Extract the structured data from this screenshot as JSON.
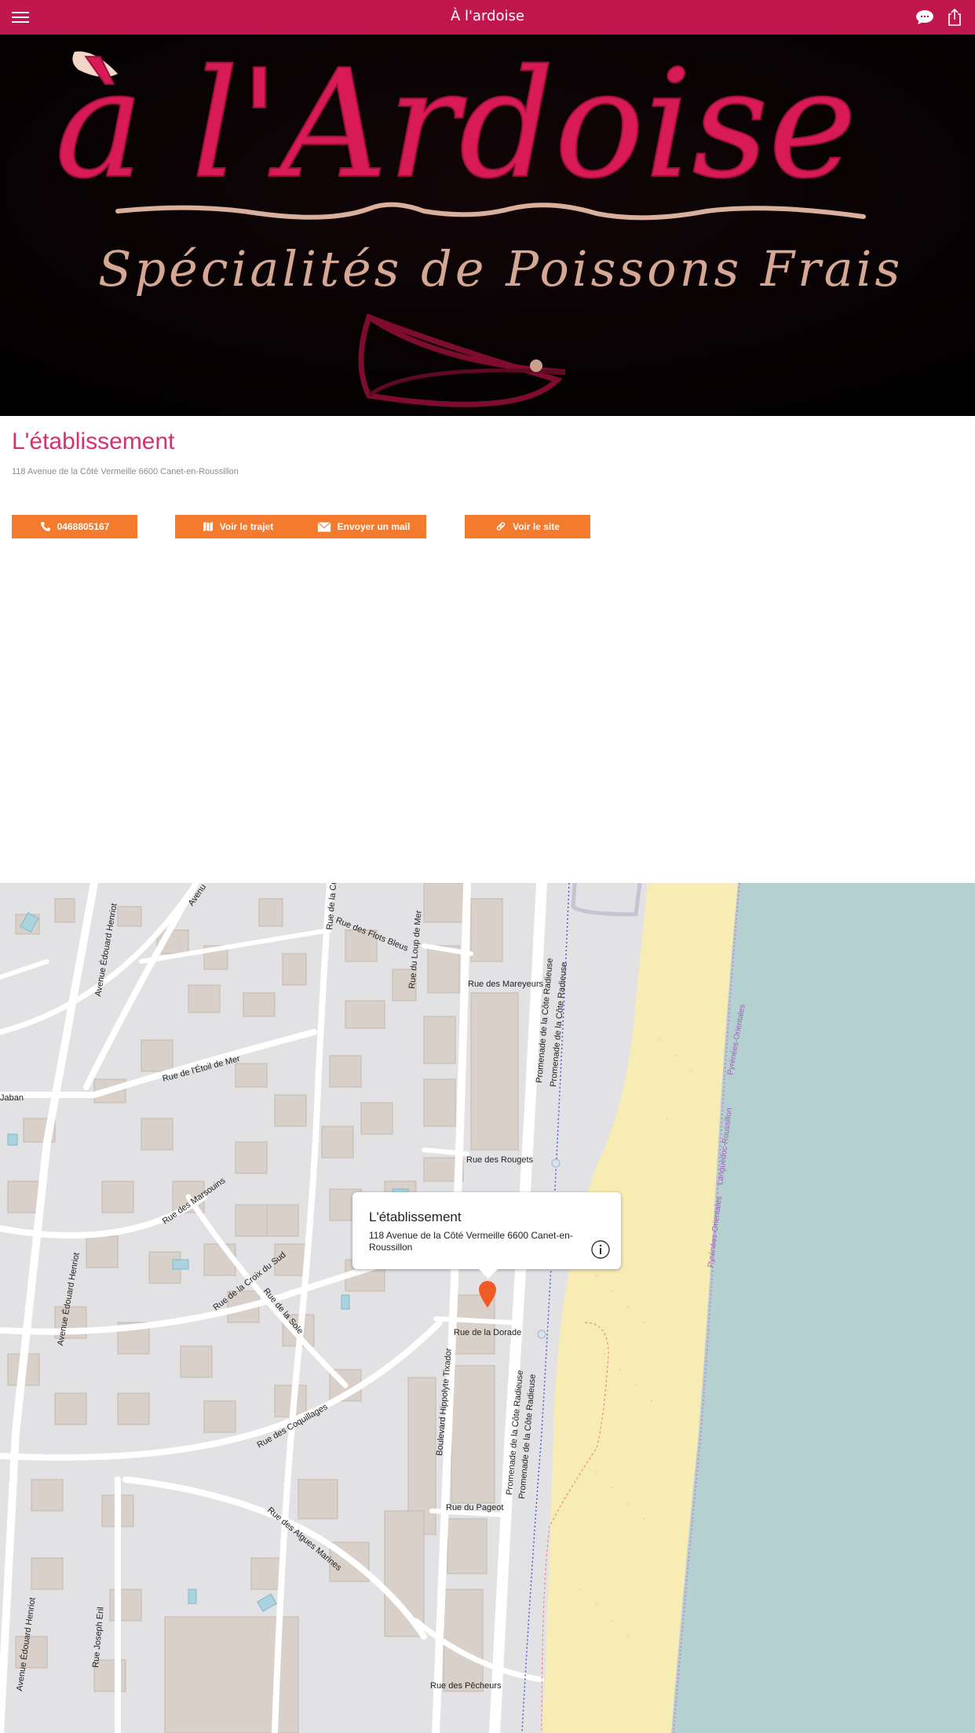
{
  "header": {
    "title": "À l'ardoise",
    "menu_icon": "hamburger-menu-icon",
    "chat_icon": "speech-bubble-icon",
    "share_icon": "share-icon",
    "bg_color": "#c0184e"
  },
  "hero": {
    "logo_text": "à l'Ardoise",
    "tagline": "Spécialités de Poissons Frais"
  },
  "establishment": {
    "title": "L'établissement",
    "address": "118 Avenue de la Côté Vermeille 6600 Canet-en-Roussillon"
  },
  "actions": {
    "phone_label": "0468805167",
    "route_label": "Voir le trajet",
    "mail_label": "Envoyer un mail",
    "site_label": "Voir le site",
    "accent": "#f47a2e"
  },
  "map": {
    "popup_title": "L'établissement",
    "popup_address": "118 Avenue de la Côté Vermeille 6600 Canet-en-Roussillon",
    "streets": {
      "edouard_henriot": "Avenue Édouard Henriot",
      "flots_bleus": "Rue des Flots Bleus",
      "loup_de_mer": "Rue du Loup de Mer",
      "mareyeurs": "Rue des Mareyeurs",
      "etoile_de_mer": "Rue de l'Étoil de Mer",
      "jaban": "Jaban",
      "marsouins": "Rue des Marsouins",
      "croix_du_sud": "Rue de la Croix du Sud",
      "sole": "Rue de la Sole",
      "rougets": "Rue des Rougets",
      "dorade": "Rue de la Dorade",
      "coquillages": "Rue des Coquillages",
      "hippolyte": "Boulevard Hippolyte Tixador",
      "pageot": "Rue du Pageot",
      "algues": "Rue des Algues Marines",
      "joseph_eril": "Rue Joseph Eril",
      "pecheurs": "Rue des Pêcheurs",
      "promenade": "Promenade de la Côte Radieuse",
      "avenue_short": "Avenu",
      "rue_de_la_cr": "Rue de la Cr",
      "region_ld": "Languedoc-Roussillon",
      "region_po": "Pyrénées-Orientales",
      "region_po2": "Pyrénées-Orientales"
    }
  }
}
